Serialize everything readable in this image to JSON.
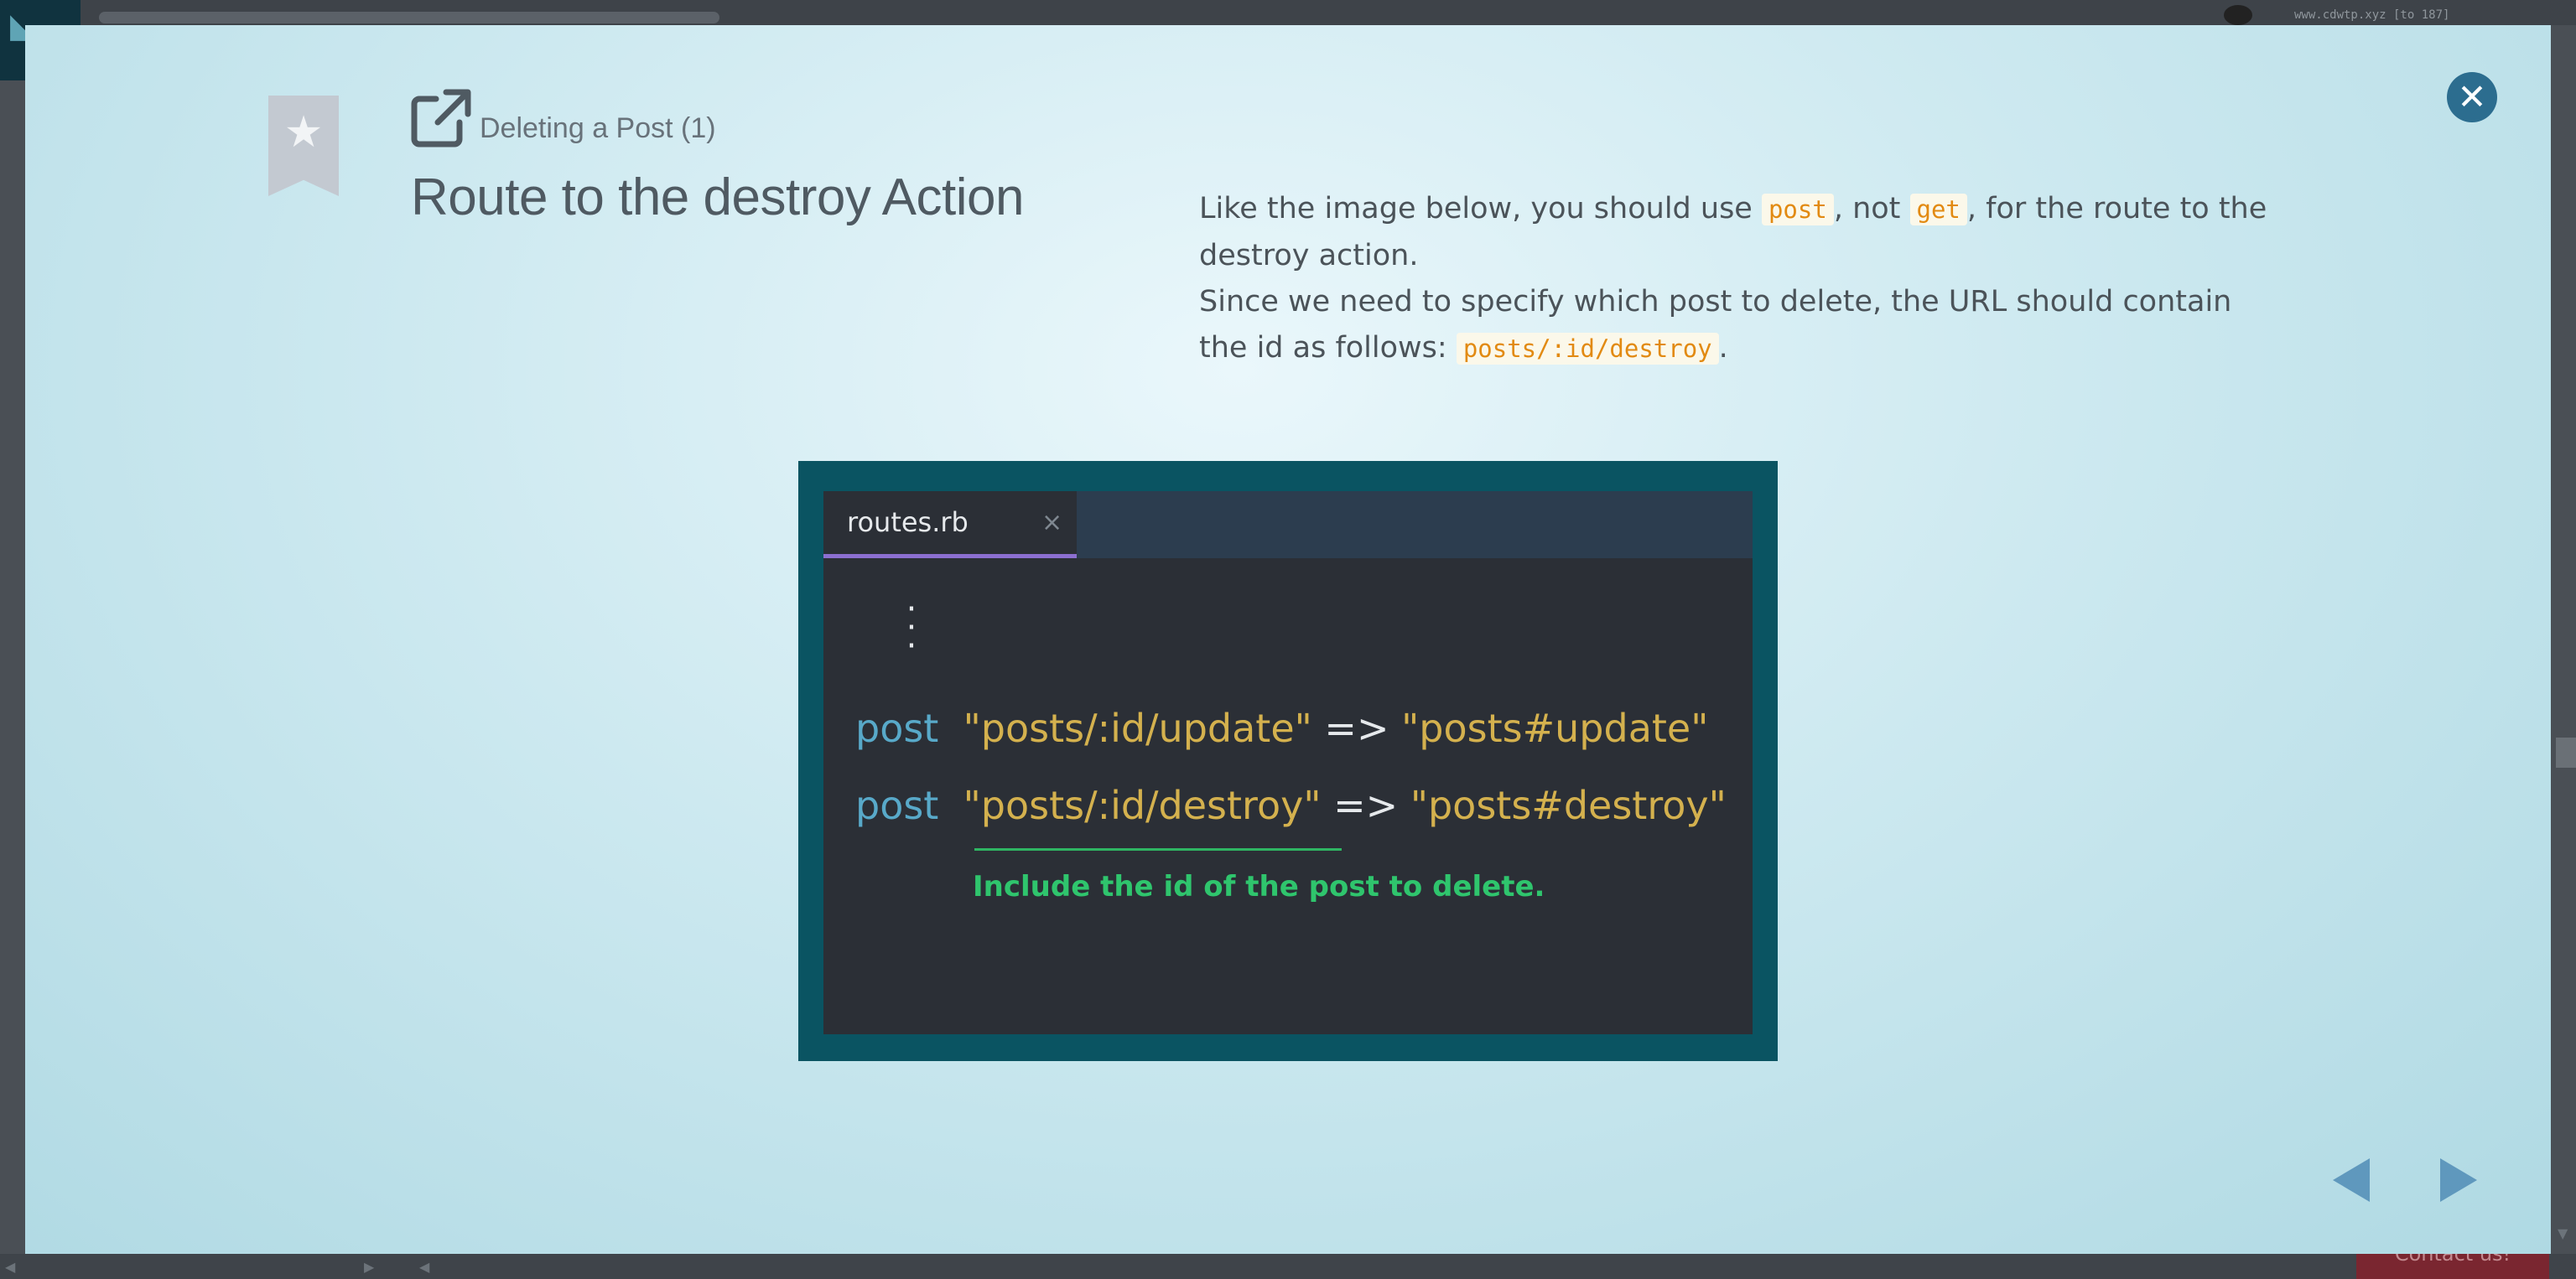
{
  "background": {
    "url_text": "www.cdwtp.xyz [to 187]",
    "contact_label": "Contact us!"
  },
  "slide": {
    "lesson_label": "Deleting a Post (1)",
    "title": "Route to the destroy Action",
    "paragraph1": {
      "t1": "Like the image below, you should use ",
      "code1": "post",
      "t2": ", not ",
      "code2": "get",
      "t3": ", for the route to the destroy action."
    },
    "paragraph2": {
      "t1": "Since we need to specify which post to delete, the URL should contain the id as follows: ",
      "code1": "posts/:id/destroy",
      "t2": "."
    }
  },
  "code_image": {
    "tab_name": "routes.rb",
    "tab_close": "×",
    "lines": [
      {
        "keyword": "post",
        "path": "\"posts/:id/update\"",
        "arrow": "=>",
        "target": "\"posts#update\""
      },
      {
        "keyword": "post",
        "path": "\"posts/:id/destroy\"",
        "arrow": "=>",
        "target": "\"posts#destroy\""
      }
    ],
    "note": "Include the id of the post to delete."
  },
  "colors": {
    "accent": "#2c6d8f",
    "code_highlight": "#e28a12",
    "note_green": "#2fc56d",
    "keyword_blue": "#58a9c9",
    "string_yellow": "#d4b14e"
  },
  "icons": {
    "close": "close-icon",
    "bookmark": "bookmark-star-icon",
    "external": "external-link-icon",
    "prev": "prev-arrow-icon",
    "next": "next-arrow-icon"
  }
}
